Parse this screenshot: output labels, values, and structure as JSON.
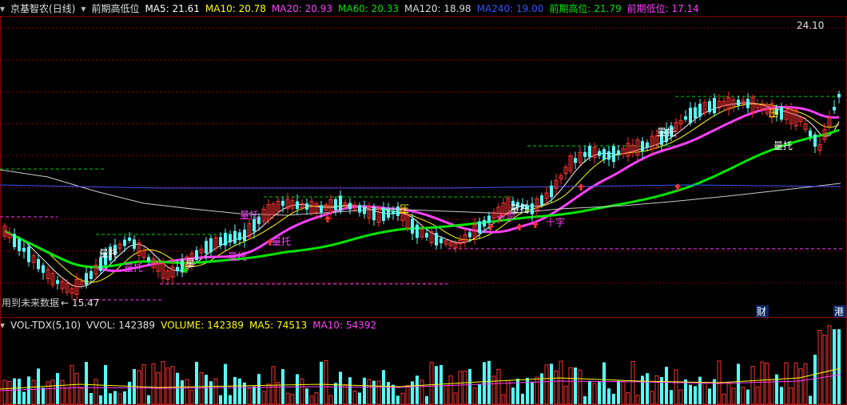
{
  "header": {
    "stock_name": "京基智农(日线)",
    "indicator_name": "前期高低位",
    "ma5": "MA5: 21.61",
    "ma10": "MA10: 20.78",
    "ma20": "MA20: 20.93",
    "ma60": "MA60: 20.33",
    "ma120": "MA120: 18.98",
    "ma240": "MA240: 19.00",
    "prev_high": "前期高位: 21.79",
    "prev_low": "前期低位: 17.14"
  },
  "volume_header": {
    "indicator": "VOL-TDX(5,10)",
    "vvol": "VVOL: 142389",
    "volume": "VOLUME: 142389",
    "ma5": "MA5: 74513",
    "ma10": "MA10: 54392"
  },
  "price_labels": {
    "high_value": "24.10",
    "low_value": "15.47",
    "future_data_note": "用到未来数据"
  },
  "annotations": {
    "support": "量托",
    "pressure": "压",
    "star": "星",
    "cross": "十字",
    "finance_badge": "财",
    "hk_badge": "港"
  },
  "colors": {
    "background": "#000000",
    "up": "#ff3232",
    "down": "#54ffff",
    "ma5": "#ffffff",
    "ma10": "#ffff00",
    "ma20": "#ff40ff",
    "ma60": "#00e600",
    "ma120": "#cccccc",
    "ma240": "#3355ff",
    "grid": "#8b0000",
    "level_high": "#00cc00",
    "level_low": "#ff40ff"
  }
}
